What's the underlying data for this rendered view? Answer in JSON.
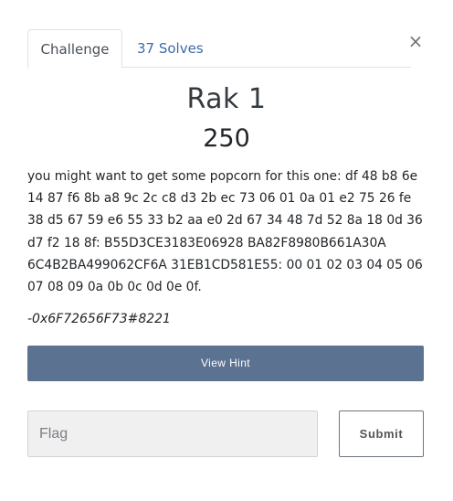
{
  "tabs": [
    {
      "label": "Challenge",
      "active": true
    },
    {
      "label": "37 Solves",
      "active": false
    }
  ],
  "close_icon": "×",
  "challenge": {
    "name": "Rak 1",
    "value": "250",
    "description": "you might want to get some popcorn for this one: df 48 b8 6e 14 87 f6 8b a8 9c 2c c8 d3 2b ec 73 06 01 0a 01 e2 75 26 fe 38 d5 67 59 e6 55 33 b2 aa e0 2d 67 34 48 7d 52 8a 18 0d 36 d7 f2 18 8f: B55D3CE3183E06928 BA82F8980B661A30A 6C4B2BA499062CF6A 31EB1CD581E55: 00 01 02 03 04 05 06 07 08 09 0a 0b 0c 0d 0e 0f.",
    "author": "-0x6F72656F73#8221"
  },
  "hint_button": "View Hint",
  "flag_input": {
    "placeholder": "Flag",
    "value": ""
  },
  "submit_button": "Submit",
  "colors": {
    "tab_link": "#3c6ca8",
    "hint_bg": "#5b7290",
    "input_bg": "#f0f0f0"
  }
}
